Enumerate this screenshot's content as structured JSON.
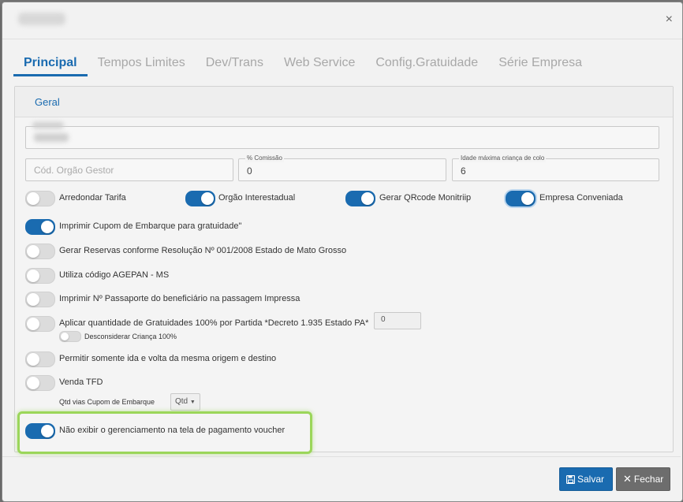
{
  "header": {
    "close_symbol": "×"
  },
  "tabs": [
    {
      "label": "Principal",
      "active": true
    },
    {
      "label": "Tempos Limites",
      "active": false
    },
    {
      "label": "Dev/Trans",
      "active": false
    },
    {
      "label": "Web Service",
      "active": false
    },
    {
      "label": "Config.Gratuidade",
      "active": false
    },
    {
      "label": "Série Empresa",
      "active": false
    }
  ],
  "panel": {
    "title": "Geral"
  },
  "fields": {
    "orgao_gestor_placeholder": "Cód. Orgão Gestor",
    "comissao": {
      "label": "% Comissão",
      "value": "0"
    },
    "idade_colo": {
      "label": "Idade máxima criança de colo",
      "value": "6"
    }
  },
  "toggles": {
    "arredondar": {
      "label": "Arredondar Tarifa",
      "on": false
    },
    "orgao_interestadual": {
      "label": "Orgão Interestadual",
      "on": true
    },
    "qrcode": {
      "label": "Gerar QRcode Monitriip",
      "on": true
    },
    "empresa_conveniada": {
      "label": "Empresa Conveniada",
      "on": true
    },
    "cupom_gratuidade": {
      "label": "Imprimir Cupom de Embarque para gratuidade\"",
      "on": true
    },
    "reservas": {
      "label": "Gerar Reservas conforme Resolução Nº 001/2008 Estado de Mato Grosso",
      "on": false
    },
    "agepan": {
      "label": "Utiliza código AGEPAN - MS",
      "on": false
    },
    "passaporte": {
      "label": "Imprimir Nº Passaporte do beneficiário na passagem Impressa",
      "on": false
    },
    "gratuidades_pa": {
      "label": "Aplicar quantidade de Gratuidades 100% por Partida *Decreto 1.935 Estado PA*",
      "on": false,
      "value": "0"
    },
    "desconsiderar_crianca": {
      "label": "Desconsiderar Criança 100%",
      "on": false
    },
    "ida_volta": {
      "label": "Permitir somente ida e volta da mesma origem e destino",
      "on": false
    },
    "venda_tfd": {
      "label": "Venda TFD",
      "on": false
    },
    "nao_exibir_gerenciamento": {
      "label": "Não exibir o gerenciamento na tela de pagamento voucher",
      "on": true
    }
  },
  "qtd_vias": {
    "label": "Qtd vias Cupom de Embarque",
    "button": "Qtd"
  },
  "footer": {
    "save_label": "Salvar",
    "close_label": "Fechar"
  }
}
